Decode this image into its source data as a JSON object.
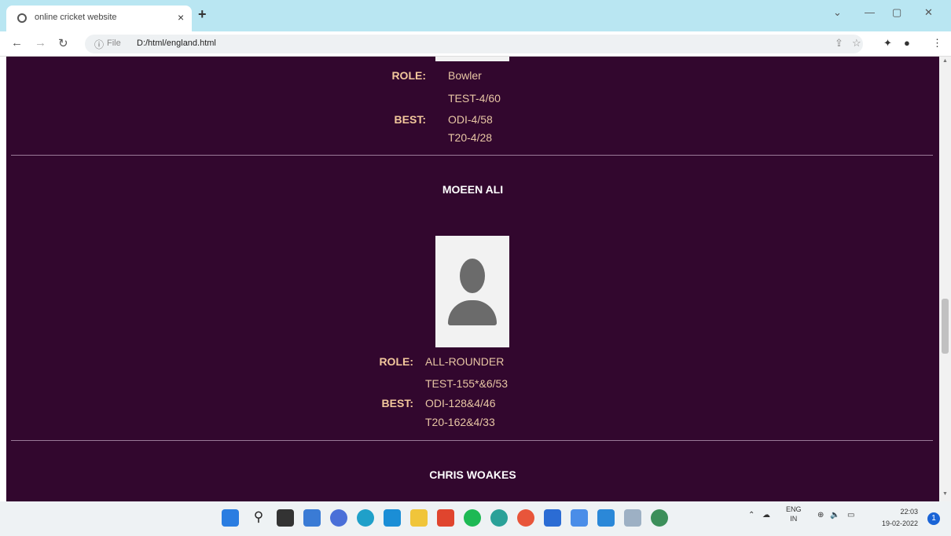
{
  "browser": {
    "tab_title": "online cricket website",
    "tab_close": "×",
    "new_tab": "+",
    "scheme": "File",
    "url": "D:/html/england.html",
    "win_minimize": "—",
    "win_maximize": "▢",
    "win_close": "✕",
    "win_dropdown": "⌄"
  },
  "players": [
    {
      "name": "",
      "role_label": "ROLE:",
      "role": "Bowler",
      "best_label": "BEST:",
      "best": [
        "TEST-4/60",
        "ODI-4/58",
        "T20-4/28"
      ]
    },
    {
      "name": "MOEEN ALI",
      "role_label": "ROLE:",
      "role": "ALL-ROUNDER",
      "best_label": "BEST:",
      "best": [
        "TEST-155*&6/53",
        "ODI-128&4/46",
        "T20-162&4/33"
      ]
    },
    {
      "name": "CHRIS WOAKES"
    }
  ],
  "taskbar": {
    "lang_top": "ENG",
    "lang_bottom": "IN",
    "time": "22:03",
    "date": "19-02-2022",
    "notification_count": "1"
  },
  "colors": {
    "page_background": "#32072e",
    "label_color": "#f2c79c",
    "value_color": "#e8c6a4",
    "name_color": "#ffffff"
  },
  "icons": [
    "globe-icon",
    "back-icon",
    "forward-icon",
    "reload-icon",
    "info-icon",
    "share-icon",
    "star-icon",
    "extensions-icon",
    "profile-icon",
    "menu-icon",
    "person-placeholder-icon",
    "windows-start-icon",
    "search-icon"
  ]
}
